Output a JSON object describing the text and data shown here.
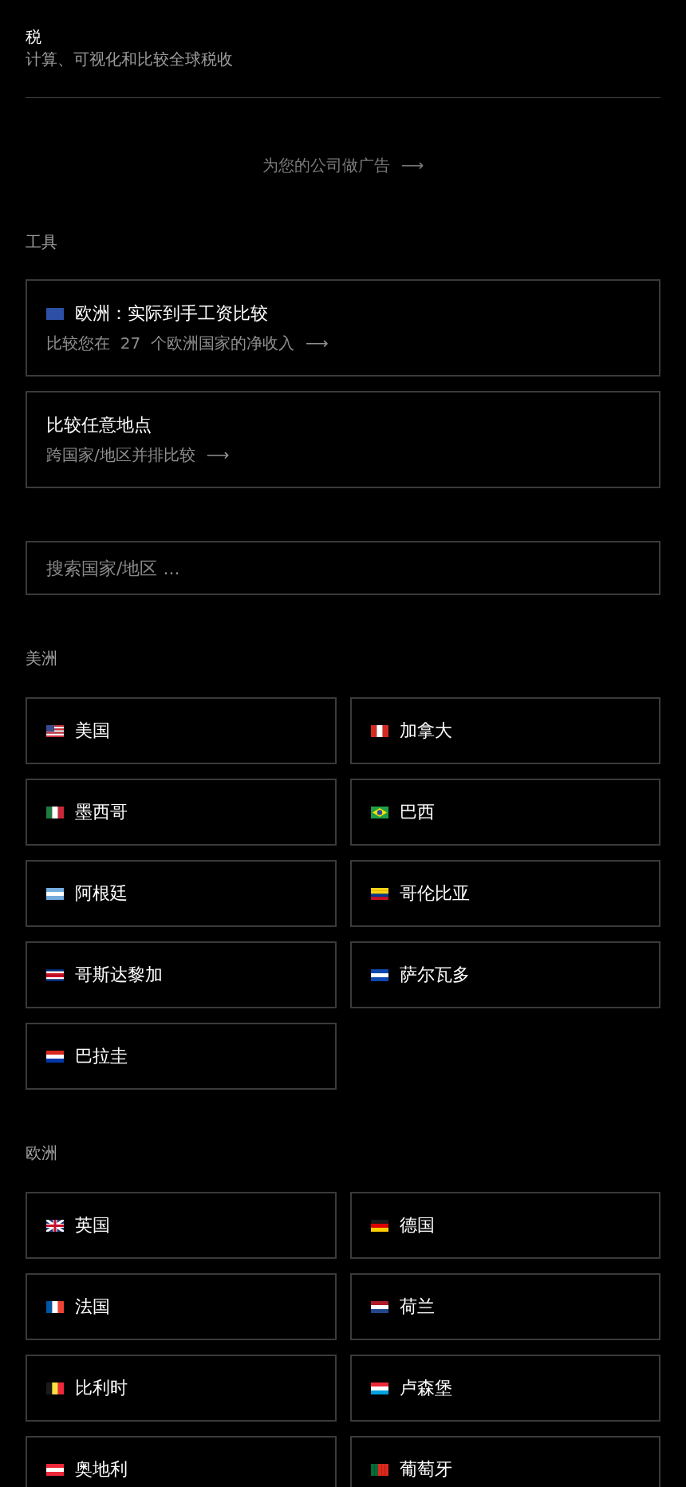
{
  "header": {
    "title": "税",
    "subtitle": "计算、可视化和比较全球税收"
  },
  "ad_link": {
    "label": "为您的公司做广告",
    "arrow": "⟶"
  },
  "tools": {
    "heading": "工具",
    "cards": [
      {
        "kind": "eu",
        "title": "欧洲：实际到手工资比较",
        "subtitle": "比较您在  27  个欧洲国家的净收入",
        "arrow": "⟶"
      },
      {
        "kind": "none",
        "title": "比较任意地点",
        "subtitle": "跨国家/地区并排比较",
        "arrow": "⟶"
      }
    ]
  },
  "search": {
    "placeholder": "搜索国家/地区 ..."
  },
  "regions": [
    {
      "heading": "美洲",
      "countries": [
        {
          "name": "美国",
          "kind": "us"
        },
        {
          "name": "加拿大",
          "kind": "ca"
        },
        {
          "name": "墨西哥",
          "kind": "mx"
        },
        {
          "name": "巴西",
          "kind": "br"
        },
        {
          "name": "阿根廷",
          "kind": "ar"
        },
        {
          "name": "哥伦比亚",
          "kind": "co"
        },
        {
          "name": "哥斯达黎加",
          "kind": "cr"
        },
        {
          "name": "萨尔瓦多",
          "kind": "sv"
        },
        {
          "name": "巴拉圭",
          "kind": "py"
        }
      ]
    },
    {
      "heading": "欧洲",
      "countries": [
        {
          "name": "英国",
          "kind": "gb"
        },
        {
          "name": "德国",
          "kind": "de"
        },
        {
          "name": "法国",
          "kind": "fr"
        },
        {
          "name": "荷兰",
          "kind": "nl"
        },
        {
          "name": "比利时",
          "kind": "be"
        },
        {
          "name": "卢森堡",
          "kind": "lu"
        },
        {
          "name": "奥地利",
          "kind": "at"
        },
        {
          "name": "葡萄牙",
          "kind": "pt"
        }
      ]
    }
  ]
}
